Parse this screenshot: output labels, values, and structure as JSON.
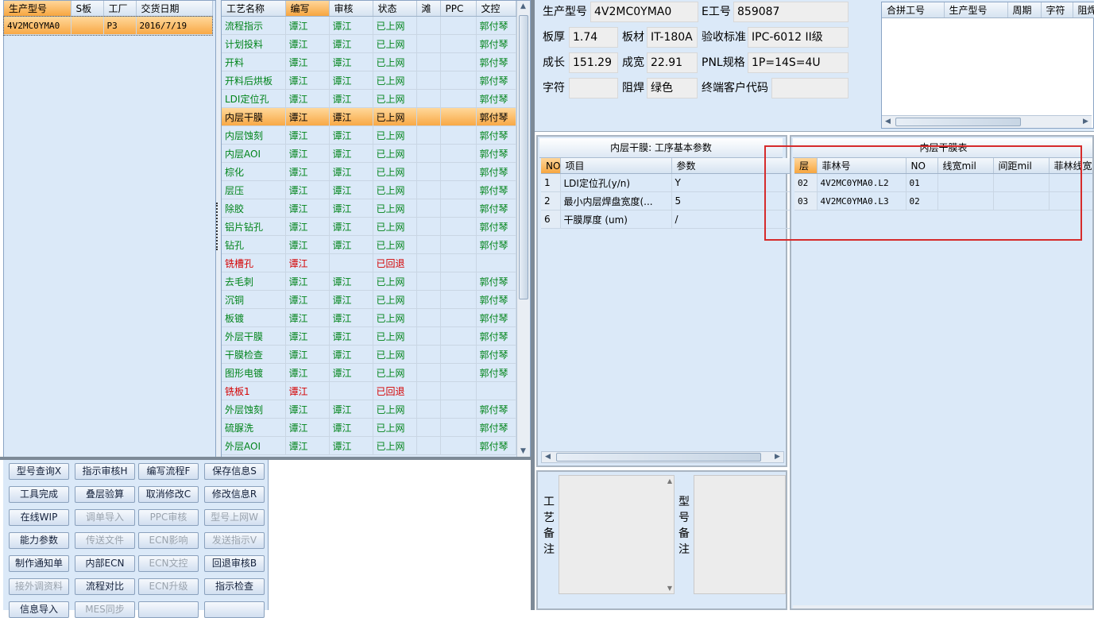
{
  "colors": {
    "highlight": "#f8a642",
    "green": "#00841a",
    "red": "#d40000",
    "pane_bg": "#dbe9f8",
    "annotation": "#d62b2b"
  },
  "left_grid": {
    "columns": [
      "生产型号",
      "S板",
      "工厂",
      "交货日期"
    ],
    "rows": [
      {
        "model": "4V2MC0YMA0",
        "s": "",
        "factory": "P3",
        "date": "2016/7/19"
      }
    ]
  },
  "process_grid": {
    "columns": [
      "工艺名称",
      "编写",
      "审核",
      "状态",
      "滩",
      "PPC",
      "文控"
    ],
    "rows": [
      {
        "name": "流程指示",
        "writer": "谭江",
        "reviewer": "谭江",
        "status": "已上网",
        "tan": "",
        "ppc": "",
        "doc": "郭付琴",
        "color": "green"
      },
      {
        "name": "计划投料",
        "writer": "谭江",
        "reviewer": "谭江",
        "status": "已上网",
        "tan": "",
        "ppc": "",
        "doc": "郭付琴",
        "color": "green"
      },
      {
        "name": "开料",
        "writer": "谭江",
        "reviewer": "谭江",
        "status": "已上网",
        "tan": "",
        "ppc": "",
        "doc": "郭付琴",
        "color": "green"
      },
      {
        "name": "开料后烘板",
        "writer": "谭江",
        "reviewer": "谭江",
        "status": "已上网",
        "tan": "",
        "ppc": "",
        "doc": "郭付琴",
        "color": "green"
      },
      {
        "name": "LDI定位孔",
        "writer": "谭江",
        "reviewer": "谭江",
        "status": "已上网",
        "tan": "",
        "ppc": "",
        "doc": "郭付琴",
        "color": "green"
      },
      {
        "name": "内层干膜",
        "writer": "谭江",
        "reviewer": "谭江",
        "status": "已上网",
        "tan": "",
        "ppc": "",
        "doc": "郭付琴",
        "color": "selected"
      },
      {
        "name": "内层蚀刻",
        "writer": "谭江",
        "reviewer": "谭江",
        "status": "已上网",
        "tan": "",
        "ppc": "",
        "doc": "郭付琴",
        "color": "green"
      },
      {
        "name": "内层AOI",
        "writer": "谭江",
        "reviewer": "谭江",
        "status": "已上网",
        "tan": "",
        "ppc": "",
        "doc": "郭付琴",
        "color": "green"
      },
      {
        "name": "棕化",
        "writer": "谭江",
        "reviewer": "谭江",
        "status": "已上网",
        "tan": "",
        "ppc": "",
        "doc": "郭付琴",
        "color": "green"
      },
      {
        "name": "层压",
        "writer": "谭江",
        "reviewer": "谭江",
        "status": "已上网",
        "tan": "",
        "ppc": "",
        "doc": "郭付琴",
        "color": "green"
      },
      {
        "name": "除胶",
        "writer": "谭江",
        "reviewer": "谭江",
        "status": "已上网",
        "tan": "",
        "ppc": "",
        "doc": "郭付琴",
        "color": "green"
      },
      {
        "name": "铝片钻孔",
        "writer": "谭江",
        "reviewer": "谭江",
        "status": "已上网",
        "tan": "",
        "ppc": "",
        "doc": "郭付琴",
        "color": "green"
      },
      {
        "name": "钻孔",
        "writer": "谭江",
        "reviewer": "谭江",
        "status": "已上网",
        "tan": "",
        "ppc": "",
        "doc": "郭付琴",
        "color": "green"
      },
      {
        "name": "铣槽孔",
        "writer": "谭江",
        "reviewer": "",
        "status": "已回退",
        "tan": "",
        "ppc": "",
        "doc": "",
        "color": "red"
      },
      {
        "name": "去毛刺",
        "writer": "谭江",
        "reviewer": "谭江",
        "status": "已上网",
        "tan": "",
        "ppc": "",
        "doc": "郭付琴",
        "color": "green"
      },
      {
        "name": "沉铜",
        "writer": "谭江",
        "reviewer": "谭江",
        "status": "已上网",
        "tan": "",
        "ppc": "",
        "doc": "郭付琴",
        "color": "green"
      },
      {
        "name": "板镀",
        "writer": "谭江",
        "reviewer": "谭江",
        "status": "已上网",
        "tan": "",
        "ppc": "",
        "doc": "郭付琴",
        "color": "green"
      },
      {
        "name": "外层干膜",
        "writer": "谭江",
        "reviewer": "谭江",
        "status": "已上网",
        "tan": "",
        "ppc": "",
        "doc": "郭付琴",
        "color": "green"
      },
      {
        "name": "干膜检查",
        "writer": "谭江",
        "reviewer": "谭江",
        "status": "已上网",
        "tan": "",
        "ppc": "",
        "doc": "郭付琴",
        "color": "green"
      },
      {
        "name": "图形电镀",
        "writer": "谭江",
        "reviewer": "谭江",
        "status": "已上网",
        "tan": "",
        "ppc": "",
        "doc": "郭付琴",
        "color": "green"
      },
      {
        "name": "铣板1",
        "writer": "谭江",
        "reviewer": "",
        "status": "已回退",
        "tan": "",
        "ppc": "",
        "doc": "",
        "color": "red"
      },
      {
        "name": "外层蚀刻",
        "writer": "谭江",
        "reviewer": "谭江",
        "status": "已上网",
        "tan": "",
        "ppc": "",
        "doc": "郭付琴",
        "color": "green"
      },
      {
        "name": "硫脲洗",
        "writer": "谭江",
        "reviewer": "谭江",
        "status": "已上网",
        "tan": "",
        "ppc": "",
        "doc": "郭付琴",
        "color": "green"
      },
      {
        "name": "外层AOI",
        "writer": "谭江",
        "reviewer": "谭江",
        "status": "已上网",
        "tan": "",
        "ppc": "",
        "doc": "郭付琴",
        "color": "green"
      }
    ]
  },
  "buttons": [
    [
      {
        "label": "型号查询X",
        "enabled": true
      },
      {
        "label": "指示审核H",
        "enabled": true
      },
      {
        "label": "编写流程F",
        "enabled": true
      },
      {
        "label": "保存信息S",
        "enabled": true
      }
    ],
    [
      {
        "label": "工具完成",
        "enabled": true
      },
      {
        "label": "叠层验算",
        "enabled": true
      },
      {
        "label": "取消修改C",
        "enabled": true
      },
      {
        "label": "修改信息R",
        "enabled": true
      }
    ],
    [
      {
        "label": "在线WIP",
        "enabled": true
      },
      {
        "label": "调单导入",
        "enabled": false
      },
      {
        "label": "PPC审核",
        "enabled": false
      },
      {
        "label": "型号上网W",
        "enabled": false
      }
    ],
    [
      {
        "label": "能力参数",
        "enabled": true
      },
      {
        "label": "传送文件",
        "enabled": false
      },
      {
        "label": "ECN影响",
        "enabled": false
      },
      {
        "label": "发送指示V",
        "enabled": false
      }
    ],
    [
      {
        "label": "制作通知单",
        "enabled": true
      },
      {
        "label": "内部ECN",
        "enabled": true
      },
      {
        "label": "ECN文控",
        "enabled": false
      },
      {
        "label": "回退审核B",
        "enabled": true
      }
    ],
    [
      {
        "label": "接外调资料",
        "enabled": false
      },
      {
        "label": "流程对比",
        "enabled": true
      },
      {
        "label": "ECN升级",
        "enabled": false
      },
      {
        "label": "指示检查",
        "enabled": true
      }
    ],
    [
      {
        "label": "信息导入",
        "enabled": true
      },
      {
        "label": "MES同步",
        "enabled": false
      },
      {
        "label": "",
        "enabled": true
      },
      {
        "label": "",
        "enabled": true
      }
    ]
  ],
  "info": {
    "model_label": "生产型号",
    "model_value": "4V2MC0YMA0",
    "e_label": "E工号",
    "e_value": "859087",
    "thick_label": "板厚",
    "thick_value": "1.74",
    "material_label": "板材",
    "material_value": "IT-180A",
    "standard_label": "验收标准",
    "standard_value": "IPC-6012 II级",
    "length_label": "成长",
    "length_value": "151.29",
    "width_label": "成宽",
    "width_value": "22.91",
    "pnl_label": "PNL规格",
    "pnl_value": "1P=14S=4U",
    "char_label": "字符",
    "char_value": "",
    "mask_label": "阻焊",
    "mask_value": "绿色",
    "customer_label": "终端客户代码",
    "customer_value": ""
  },
  "merge_grid": {
    "columns": [
      "合拼工号",
      "生产型号",
      "周期",
      "字符",
      "阻焊"
    ]
  },
  "param_panel": {
    "title": "内层干膜: 工序基本参数",
    "columns": [
      "NO",
      "项目",
      "参数"
    ],
    "rows": [
      {
        "no": "1",
        "item": "LDI定位孔(y/n)",
        "value": "Y"
      },
      {
        "no": "2",
        "item": "最小内层焊盘宽度(...",
        "value": "5"
      },
      {
        "no": "6",
        "item": "干膜厚度 (um)",
        "value": "/"
      }
    ]
  },
  "film_panel": {
    "title": "内层干膜表",
    "columns": [
      "层",
      "菲林号",
      "NO",
      "线宽mil",
      "间距mil",
      "菲林线宽"
    ],
    "rows": [
      {
        "layer": "02",
        "film": "4V2MC0YMA0.L2",
        "no": "01",
        "lw": "",
        "sp": "",
        "flw": ""
      },
      {
        "layer": "03",
        "film": "4V2MC0YMA0.L3",
        "no": "02",
        "lw": "",
        "sp": "",
        "flw": ""
      }
    ]
  },
  "memos": {
    "process_note_label": "工艺备注",
    "model_note_label": "型号备注"
  }
}
